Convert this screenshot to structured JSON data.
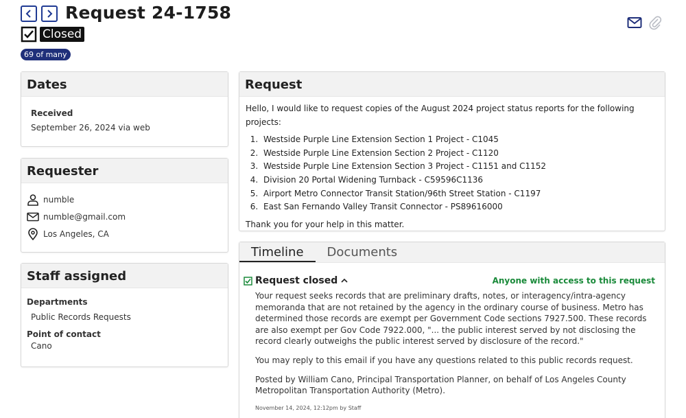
{
  "header": {
    "title": "Request 24-1758",
    "status": "Closed",
    "count_badge": "69 of many"
  },
  "dates": {
    "heading": "Dates",
    "received_label": "Received",
    "received_value": "September 26, 2024 via web"
  },
  "requester": {
    "heading": "Requester",
    "name": "numble",
    "email": "numble@gmail.com",
    "location": "Los Angeles, CA"
  },
  "staff": {
    "heading": "Staff assigned",
    "departments_label": "Departments",
    "departments_value": "Public Records Requests",
    "contact_label": "Point of contact",
    "contact_value": "Cano"
  },
  "request": {
    "heading": "Request",
    "intro": "Hello, I would like to request copies of the August 2024 project status reports for the following projects:",
    "items": [
      "Westside Purple Line Extension Section 1 Project - C1045",
      "Westside Purple Line Extension Section 2 Project - C1120",
      "Westside Purple Line Extension Section 3 Project - C1151 and C1152",
      "Division 20 Portal Widening Turnback - C59596C1136",
      "Airport Metro Connector Transit Station/96th Street Station - C1197",
      "East San Fernando Valley Transit Connector - PS89616000"
    ],
    "closing": "Thank you for your help in this matter."
  },
  "tabs": {
    "timeline": "Timeline",
    "documents": "Documents"
  },
  "event": {
    "title": "Request closed",
    "visibility": "Anyone with access to this request",
    "paragraph1": "Your request seeks records that are preliminary drafts, notes, or interagency/intra-agency memoranda that are not retained by the agency in the ordinary course of business. Metro has determined those records are exempt per Government Code sections 7927.500. These records are also exempt per Gov Code 7922.000, \"... the public interest served by not disclosing the record clearly outweighs the public interest served by disclosure of the record.\"",
    "paragraph2": "You may reply to this email if you have any questions related to this public records request.",
    "paragraph3": "Posted by William Cano, Principal Transportation Planner, on behalf of Los Angeles County Metropolitan Transportation Authority (Metro).",
    "meta": "November 14, 2024, 12:12pm by Staff"
  },
  "colors": {
    "nav_blue": "#1f3a93",
    "badge_navy": "#1f2f7a",
    "public_green": "#1a8a3a"
  }
}
